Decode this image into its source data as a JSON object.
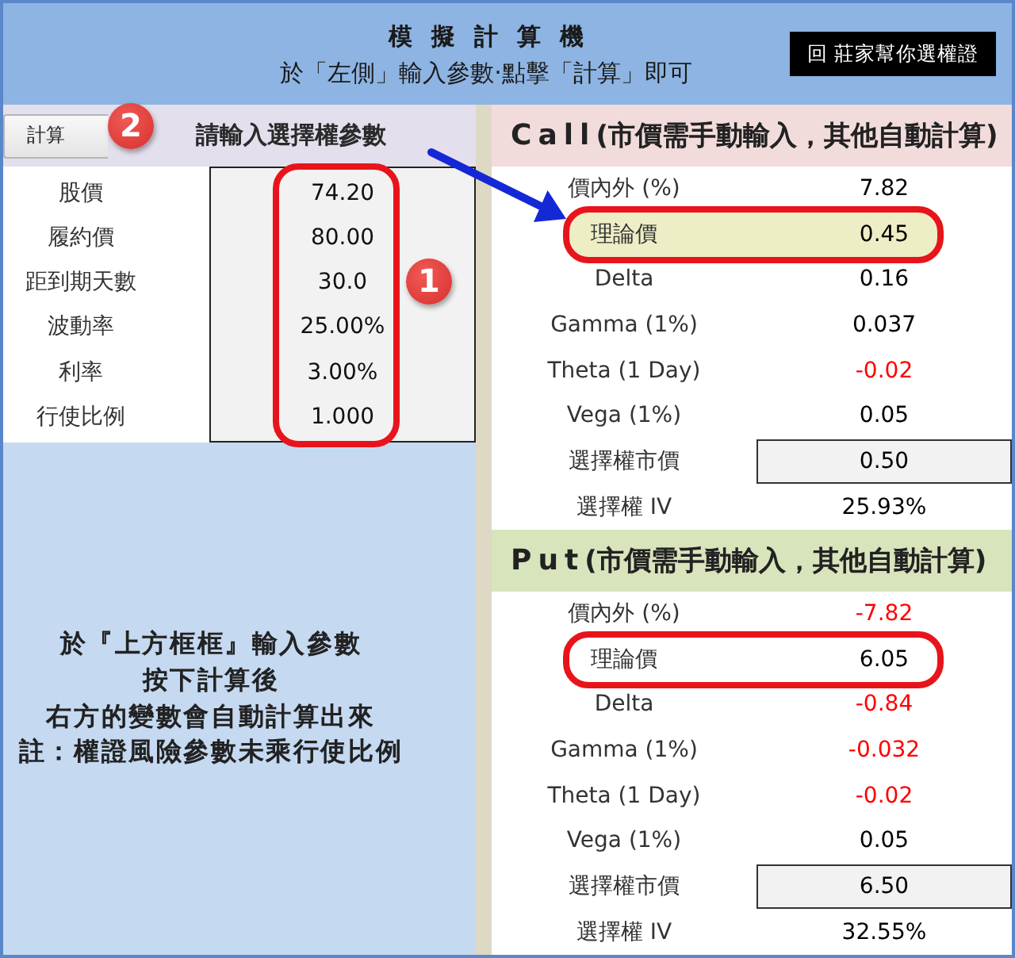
{
  "header": {
    "title": "模擬計算機",
    "subtitle": "於「左側」輸入參數‧點擊「計算」即可",
    "link_button": "回 莊家幫你選權證"
  },
  "inputs": {
    "calculate_button": "計算",
    "calculate_badge": "2",
    "heading": "請輸入選擇權參數",
    "badge": "1",
    "circled": true,
    "params": [
      {
        "label": "股價",
        "value": "74.20"
      },
      {
        "label": "履約價",
        "value": "80.00"
      },
      {
        "label": "距到期天數",
        "value": "30.0"
      },
      {
        "label": "波動率",
        "value": "25.00%"
      },
      {
        "label": "利率",
        "value": "3.00%"
      },
      {
        "label": "行使比例",
        "value": "1.000"
      }
    ]
  },
  "note": {
    "lines": [
      "於『上方框框』輸入參數",
      "按下計算後",
      "右方的變數會自動計算出來",
      "註：權證風險參數未乘行使比例"
    ]
  },
  "call": {
    "title": "Call",
    "subtitle": "(市價需手動輸入，其他自動計算)",
    "rows": [
      {
        "label": "價內外 (%)",
        "value": "7.82",
        "color": "#000000",
        "kind": "output",
        "circled": false,
        "highlighted": false
      },
      {
        "label": "理論價",
        "value": "0.45",
        "color": "#000000",
        "kind": "output",
        "circled": true,
        "highlighted": true
      },
      {
        "label": "Delta",
        "value": "0.16",
        "color": "#000000",
        "kind": "output",
        "circled": false,
        "highlighted": false
      },
      {
        "label": "Gamma (1%)",
        "value": "0.037",
        "color": "#000000",
        "kind": "output",
        "circled": false,
        "highlighted": false
      },
      {
        "label": "Theta (1 Day)",
        "value": "-0.02",
        "color": "#ff0000",
        "kind": "output",
        "circled": false,
        "highlighted": false
      },
      {
        "label": "Vega (1%)",
        "value": "0.05",
        "color": "#000000",
        "kind": "output",
        "circled": false,
        "highlighted": false
      },
      {
        "label": "選擇權市價",
        "value": "0.50",
        "color": "#000000",
        "kind": "input",
        "circled": false,
        "highlighted": false
      },
      {
        "label": "選擇權 IV",
        "value": "25.93%",
        "color": "#000000",
        "kind": "output",
        "circled": false,
        "highlighted": false
      }
    ]
  },
  "put": {
    "title": "Put",
    "subtitle": "(市價需手動輸入，其他自動計算)",
    "rows": [
      {
        "label": "價內外 (%)",
        "value": "-7.82",
        "color": "#ff0000",
        "kind": "output",
        "circled": false,
        "highlighted": false
      },
      {
        "label": "理論價",
        "value": "6.05",
        "color": "#000000",
        "kind": "output",
        "circled": true,
        "highlighted": false
      },
      {
        "label": "Delta",
        "value": "-0.84",
        "color": "#ff0000",
        "kind": "output",
        "circled": false,
        "highlighted": false
      },
      {
        "label": "Gamma (1%)",
        "value": "-0.032",
        "color": "#ff0000",
        "kind": "output",
        "circled": false,
        "highlighted": false
      },
      {
        "label": "Theta (1 Day)",
        "value": "-0.02",
        "color": "#ff0000",
        "kind": "output",
        "circled": false,
        "highlighted": false
      },
      {
        "label": "Vega (1%)",
        "value": "0.05",
        "color": "#000000",
        "kind": "output",
        "circled": false,
        "highlighted": false
      },
      {
        "label": "選擇權市價",
        "value": "6.50",
        "color": "#000000",
        "kind": "input",
        "circled": false,
        "highlighted": false
      },
      {
        "label": "選擇權 IV",
        "value": "32.55%",
        "color": "#000000",
        "kind": "output",
        "circled": false,
        "highlighted": false
      }
    ]
  }
}
